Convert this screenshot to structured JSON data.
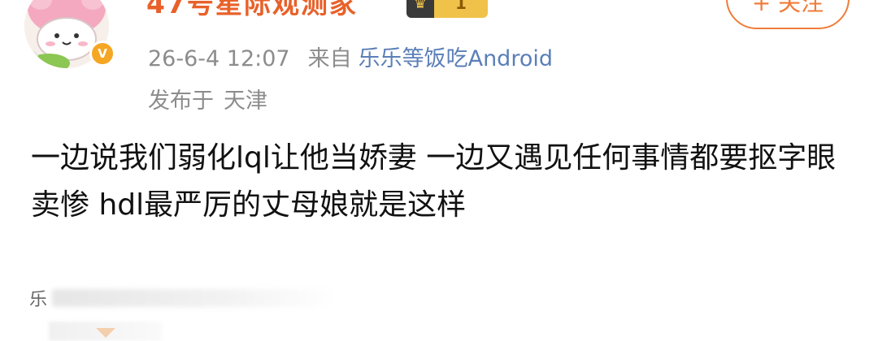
{
  "post": {
    "author": {
      "name": "47号星际观测家",
      "level_badge": "1",
      "avatar": "pink-bunny-hat-cartoon",
      "verified_mark": "V"
    },
    "follow_button": {
      "label": "+ 关注"
    },
    "meta": {
      "timestamp": "26-6-4 12:07",
      "from_label": "来自",
      "source": "乐乐等饭吃Android"
    },
    "location": {
      "prefix": "发布于",
      "place": "天津"
    },
    "body": "一边说我们弱化lql让他当娇妻 一边又遇见任何事情都要抠字眼卖惨 hdl最严厉的丈母娘就是这样"
  },
  "comment_preview": {
    "first_char": "乐"
  },
  "colors": {
    "username": "#e8612a",
    "source_link": "#5b7fb7",
    "follow_border": "#f07c3a",
    "verified_badge": "#f5a623"
  }
}
